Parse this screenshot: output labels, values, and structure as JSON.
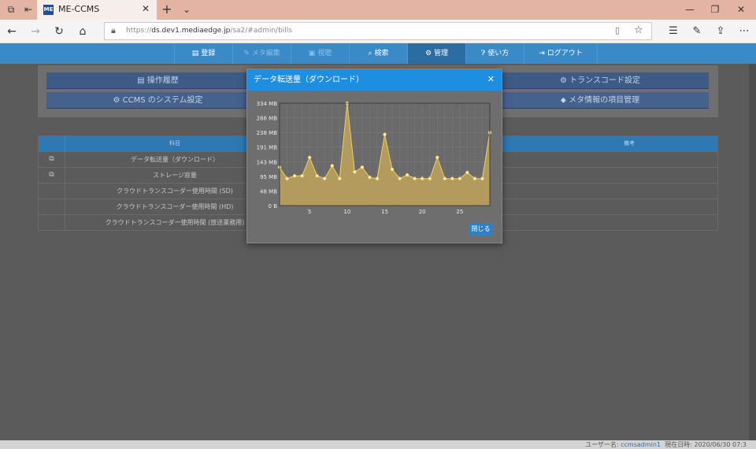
{
  "browser": {
    "tab_title": "ME-CCMS",
    "favicon_text": "ME",
    "url_prefix": "https://",
    "url_host": "ds.dev1.mediaedge.jp",
    "url_path": "/sa2/#admin/bills"
  },
  "nav": {
    "items": [
      {
        "label": "登録",
        "icon": "document-icon",
        "state": "normal"
      },
      {
        "label": "メタ編集",
        "icon": "pencil-icon",
        "state": "disabled"
      },
      {
        "label": "視聴",
        "icon": "play-icon",
        "state": "disabled"
      },
      {
        "label": "検索",
        "icon": "search-icon",
        "state": "normal"
      },
      {
        "label": "管理",
        "icon": "gear-icon",
        "state": "active"
      },
      {
        "label": "使い方",
        "icon": "help-icon",
        "state": "normal"
      },
      {
        "label": "ログアウト",
        "icon": "logout-icon",
        "state": "normal"
      }
    ]
  },
  "admin_menu": {
    "operation_history": "操作履歴",
    "transcode_settings": "トランスコード設定",
    "system_settings": "CCMS のシステム設定",
    "meta_items": "メタ情報の項目管理"
  },
  "table": {
    "headers": {
      "item": "科目",
      "note": "備考"
    },
    "rows": [
      {
        "name": "データ転送量（ダウンロード）",
        "has_icon": true
      },
      {
        "name": "ストレージ容量",
        "has_icon": true
      },
      {
        "name": "クラウドトランスコーダー使用時間 (SD)",
        "has_icon": false
      },
      {
        "name": "クラウドトランスコーダー使用時間 (HD)",
        "has_icon": false
      },
      {
        "name": "クラウドトランスコーダー使用時間 (放送業務用)",
        "has_icon": false
      }
    ]
  },
  "modal": {
    "title": "データ転送量（ダウンロード）",
    "close_button": "閉じる"
  },
  "status": {
    "user_label": "ユーザー名:",
    "user_name": "ccmsadmin1",
    "datetime_label": "現在日時:",
    "datetime_value": "2020/06/30 07:3"
  },
  "colors": {
    "accent": "#1e8fe0",
    "nav": "#3a8ac8",
    "chart_fill": "#c0a35a",
    "chart_line": "#f2cf63"
  },
  "chart_data": {
    "type": "area",
    "ylabel": "",
    "xlabel": "",
    "yticks": [
      "0 B",
      "48 MB",
      "95 MB",
      "143 MB",
      "191 MB",
      "238 MB",
      "286 MB",
      "334 MB"
    ],
    "ylim": [
      0,
      334
    ],
    "xticks": [
      5,
      10,
      15,
      20,
      25
    ],
    "xlim": [
      1,
      29
    ],
    "x": [
      1,
      2,
      3,
      4,
      5,
      6,
      7,
      8,
      9,
      10,
      11,
      12,
      13,
      14,
      15,
      16,
      17,
      18,
      19,
      20,
      21,
      22,
      23,
      24,
      25,
      26,
      27,
      28,
      29
    ],
    "series": [
      {
        "unit": "MB",
        "values": [
          125,
          88,
          97,
          97,
          157,
          97,
          88,
          130,
          88,
          334,
          110,
          125,
          92,
          88,
          232,
          118,
          88,
          100,
          88,
          88,
          88,
          157,
          88,
          88,
          88,
          108,
          88,
          88,
          238
        ]
      }
    ],
    "grid": true,
    "legend": "none"
  }
}
